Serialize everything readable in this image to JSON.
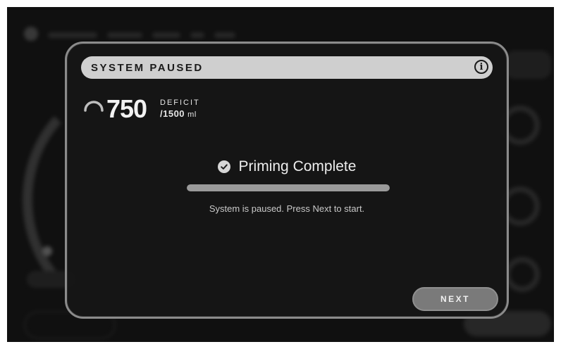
{
  "dialog": {
    "title": "SYSTEM PAUSED",
    "info_icon": "info-icon"
  },
  "deficit": {
    "value": "750",
    "label": "DEFICIT",
    "total": "/1500",
    "unit": "ml",
    "gauge_fraction": 0.5
  },
  "status": {
    "icon": "check-circle-icon",
    "text": "Priming Complete"
  },
  "progress": {
    "fraction": 1.0
  },
  "message": "System is paused. Press Next to start.",
  "actions": {
    "next_label": "NEXT"
  },
  "colors": {
    "accent": "#cfcfcf",
    "background": "#101010",
    "button": "#7a7a7a"
  }
}
